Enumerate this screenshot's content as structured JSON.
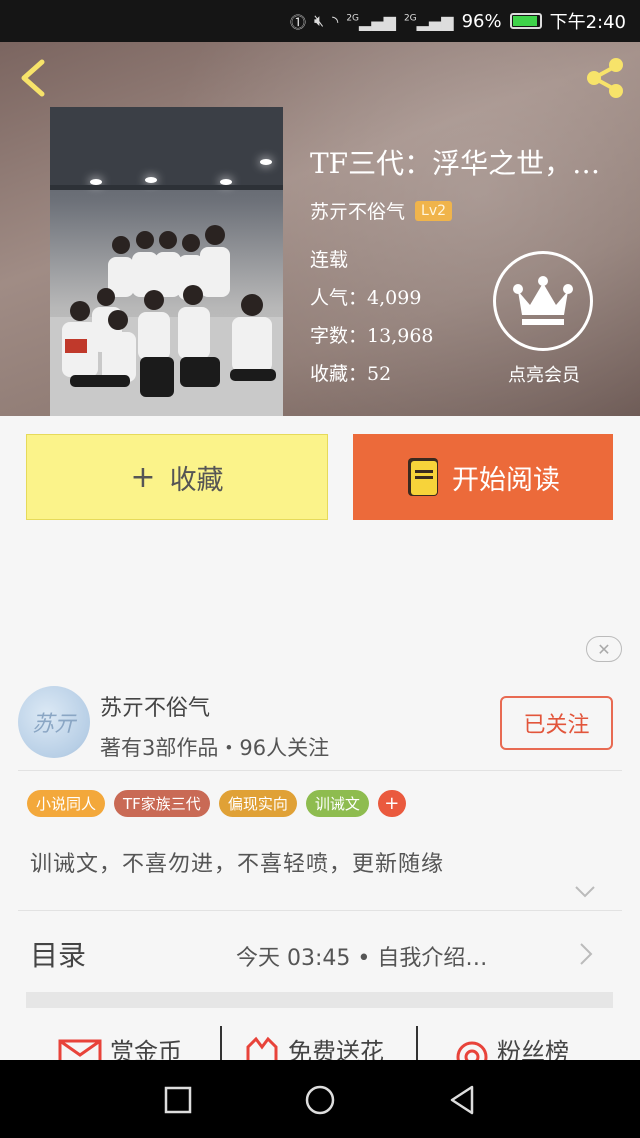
{
  "status_bar": {
    "battery": "96%",
    "time": "下午2:40",
    "icons": [
      "hd-icon",
      "mute-icon",
      "wifi-icon",
      "signal-2g-icon",
      "signal-2g-icon-2",
      "battery-icon"
    ],
    "network_1": "2G",
    "network_2": "2G",
    "battery_level": 0.96
  },
  "header": {
    "title": "TF三代：浮华之世，…",
    "author": "苏亓不俗气",
    "level": "Lv2",
    "status": "连载",
    "popularity_label": "人气：",
    "popularity": "4,099",
    "words_label": "字数：",
    "words": "13,968",
    "favorites_label": "收藏：",
    "favorites": "52",
    "vip_label": "点亮会员"
  },
  "buttons": {
    "favorite": "收藏",
    "favorite_plus": "+",
    "read": "开始阅读"
  },
  "author_card": {
    "name": "苏亓不俗气",
    "stats": "著有3部作品・96人关注",
    "follow": "已关注",
    "avatar_text": "苏亓"
  },
  "tags": [
    {
      "label": "小说同人",
      "color": "#f3a83b"
    },
    {
      "label": "TF家族三代",
      "color": "#c96a55"
    },
    {
      "label": "偏现实向",
      "color": "#e0a136"
    },
    {
      "label": "训诫文",
      "color": "#8ebc4f"
    }
  ],
  "tag_add": "+",
  "description": "训诫文，不喜勿进，不喜轻喷，更新随缘",
  "toc": {
    "label": "目录",
    "latest": "今天 03:45 • 自我介绍…"
  },
  "actions": [
    {
      "label": "赏金币",
      "icon": "envelope-icon",
      "color": "#e8433a"
    },
    {
      "label": "免费送花",
      "icon": "flower-icon",
      "color": "#e8433a"
    },
    {
      "label": "粉丝榜",
      "icon": "ranking-icon",
      "color": "#e8433a"
    }
  ],
  "colors": {
    "accent": "#ec6a3a",
    "favorite_bg": "#fbf38a",
    "follow_red": "#e2553b"
  }
}
